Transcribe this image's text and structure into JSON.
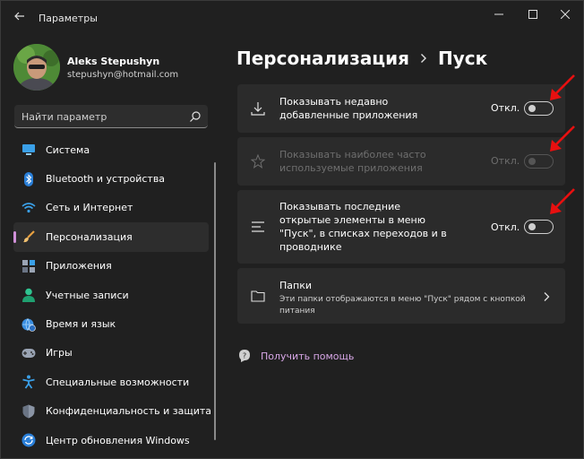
{
  "window": {
    "title": "Параметры"
  },
  "profile": {
    "name": "Aleks Stepushyn",
    "email": "stepushyn@hotmail.com"
  },
  "search": {
    "placeholder": "Найти параметр"
  },
  "nav": {
    "items": [
      {
        "label": "Система",
        "icon": "monitor-icon"
      },
      {
        "label": "Bluetooth и устройства",
        "icon": "bluetooth-icon"
      },
      {
        "label": "Сеть и Интернет",
        "icon": "wifi-icon"
      },
      {
        "label": "Персонализация",
        "icon": "brush-icon",
        "active": true
      },
      {
        "label": "Приложения",
        "icon": "apps-icon"
      },
      {
        "label": "Учетные записи",
        "icon": "person-icon"
      },
      {
        "label": "Время и язык",
        "icon": "globe-clock-icon"
      },
      {
        "label": "Игры",
        "icon": "gamepad-icon"
      },
      {
        "label": "Специальные возможности",
        "icon": "accessibility-icon"
      },
      {
        "label": "Конфиденциальность и защита",
        "icon": "shield-icon"
      },
      {
        "label": "Центр обновления Windows",
        "icon": "update-icon"
      }
    ]
  },
  "breadcrumb": {
    "parent": "Персонализация",
    "current": "Пуск"
  },
  "settings": [
    {
      "icon": "download-icon",
      "line1": "Показывать недавно",
      "line2": "добавленные приложения",
      "state": "Откл.",
      "enabled": true
    },
    {
      "icon": "star-icon",
      "line1": "Показывать наиболее часто",
      "line2": "используемые приложения",
      "state": "Откл.",
      "enabled": false
    },
    {
      "icon": "list-icon",
      "line1": "Показывать последние",
      "line2": "открытые элементы в меню",
      "line3": "\"Пуск\", в списках переходов и в",
      "line4": "проводнике",
      "state": "Откл.",
      "enabled": true
    }
  ],
  "folders": {
    "title": "Папки",
    "description": "Эти папки отображаются в меню \"Пуск\" рядом с кнопкой питания"
  },
  "help": {
    "label": "Получить помощь"
  },
  "colors": {
    "background": "#202020",
    "card": "#2b2b2b",
    "accent": "#d090d8",
    "annotation": "#e81010"
  }
}
